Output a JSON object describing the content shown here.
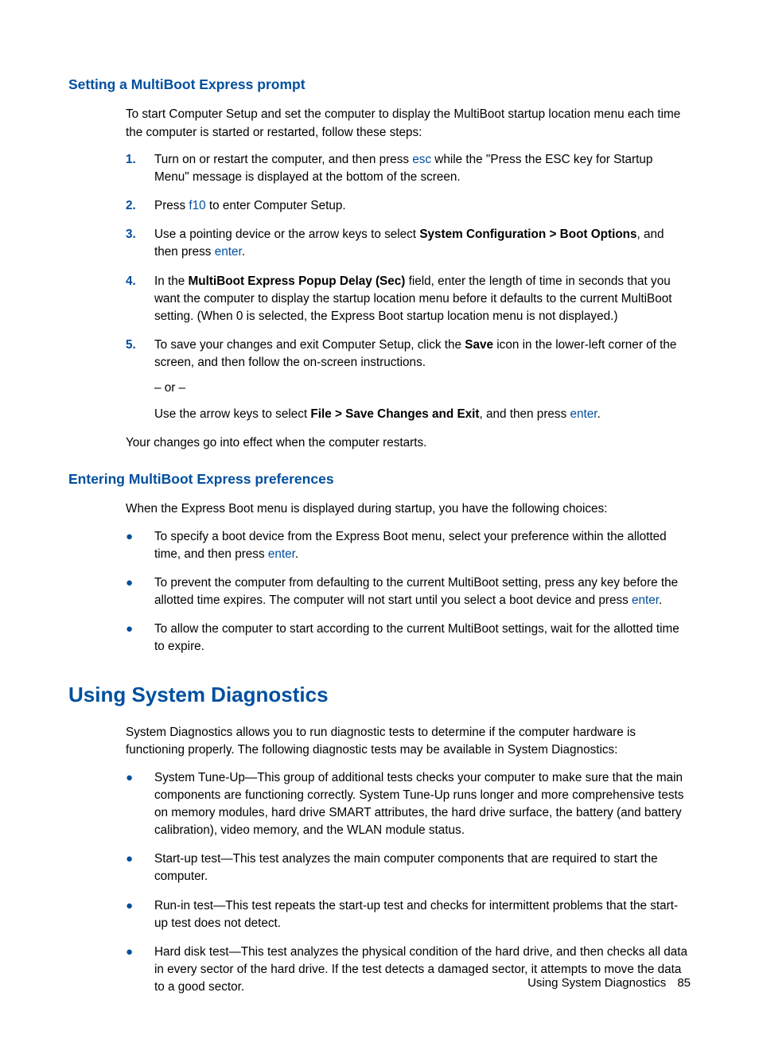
{
  "sec1": {
    "heading": "Setting a MultiBoot Express prompt",
    "intro": "To start Computer Setup and set the computer to display the MultiBoot startup location menu each time the computer is started or restarted, follow these steps:",
    "steps": {
      "s1a": "Turn on or restart the computer, and then press ",
      "s1k": "esc",
      "s1b": " while the \"Press the ESC key for Startup Menu\" message is displayed at the bottom of the screen.",
      "s2a": "Press ",
      "s2k": "f10",
      "s2b": " to enter Computer Setup.",
      "s3a": "Use a pointing device or the arrow keys to select ",
      "s3b": "System Configuration > Boot Options",
      "s3c": ", and then press ",
      "s3k": "enter",
      "s3d": ".",
      "s4a": "In the ",
      "s4b": "MultiBoot Express Popup Delay (Sec)",
      "s4c": " field, enter the length of time in seconds that you want the computer to display the startup location menu before it defaults to the current MultiBoot setting. (When 0 is selected, the Express Boot startup location menu is not displayed.)",
      "s5a": "To save your changes and exit Computer Setup, click the ",
      "s5b": "Save",
      "s5c": " icon in the lower-left corner of the screen, and then follow the on-screen instructions.",
      "s5or": "– or –",
      "s5d": "Use the arrow keys to select ",
      "s5e": "File > Save Changes and Exit",
      "s5f": ", and then press ",
      "s5k": "enter",
      "s5g": "."
    },
    "outro": "Your changes go into effect when the computer restarts."
  },
  "sec2": {
    "heading": "Entering MultiBoot Express preferences",
    "intro": "When the Express Boot menu is displayed during startup, you have the following choices:",
    "b1a": "To specify a boot device from the Express Boot menu, select your preference within the allotted time, and then press ",
    "b1k": "enter",
    "b1b": ".",
    "b2a": "To prevent the computer from defaulting to the current MultiBoot setting, press any key before the allotted time expires. The computer will not start until you select a boot device and press ",
    "b2k": "enter",
    "b2b": ".",
    "b3": "To allow the computer to start according to the current MultiBoot settings, wait for the allotted time to expire."
  },
  "sec3": {
    "heading": "Using System Diagnostics",
    "intro": "System Diagnostics allows you to run diagnostic tests to determine if the computer hardware is functioning properly. The following diagnostic tests may be available in System Diagnostics:",
    "b1": "System Tune-Up—This group of additional tests checks your computer to make sure that the main components are functioning correctly. System Tune-Up runs longer and more comprehensive tests on memory modules, hard drive SMART attributes, the hard drive surface, the battery (and battery calibration), video memory, and the WLAN module status.",
    "b2": "Start-up test—This test analyzes the main computer components that are required to start the computer.",
    "b3": "Run-in test—This test repeats the start-up test and checks for intermittent problems that the start-up test does not detect.",
    "b4": "Hard disk test—This test analyzes the physical condition of the hard drive, and then checks all data in every sector of the hard drive. If the test detects a damaged sector, it attempts to move the data to a good sector."
  },
  "footer": {
    "title": "Using System Diagnostics",
    "page": "85"
  },
  "nums": {
    "n1": "1.",
    "n2": "2.",
    "n3": "3.",
    "n4": "4.",
    "n5": "5."
  },
  "bullet": "●"
}
